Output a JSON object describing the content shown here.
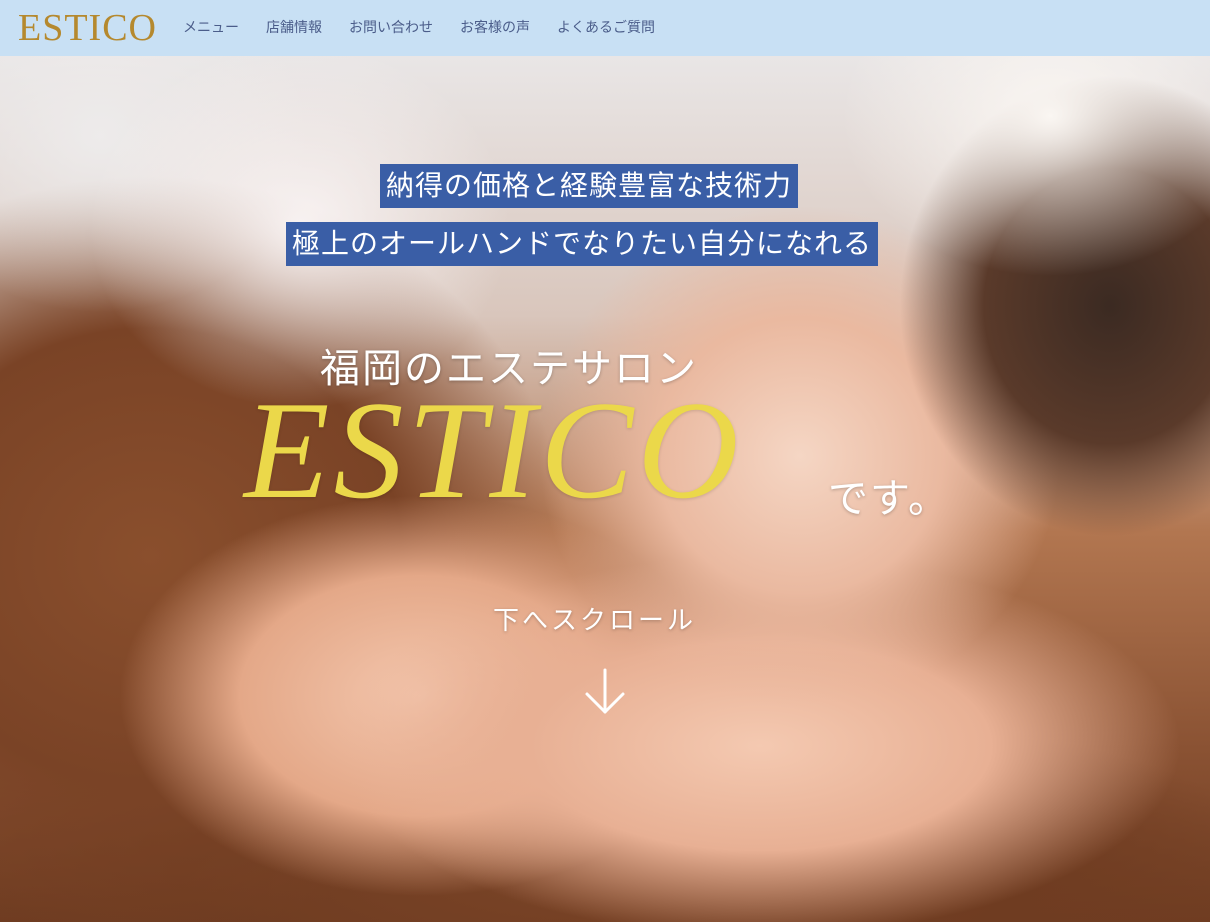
{
  "header": {
    "logo": "ESTICO",
    "nav": [
      "メニュー",
      "店舗情報",
      "お問い合わせ",
      "お客様の声",
      "よくあるご質問"
    ]
  },
  "hero": {
    "band1": "納得の価格と経験豊富な技術力",
    "band2": "極上のオールハンドでなりたい自分になれる",
    "subtitle": "福岡のエステサロン",
    "brand": "ESTICO",
    "suffix": "です。",
    "scroll_label": "下へスクロール"
  },
  "colors": {
    "header_bg": "#c8e0f4",
    "logo": "#b5892e",
    "band_bg": "#3a5ea6",
    "brand": "#ebd84a"
  }
}
